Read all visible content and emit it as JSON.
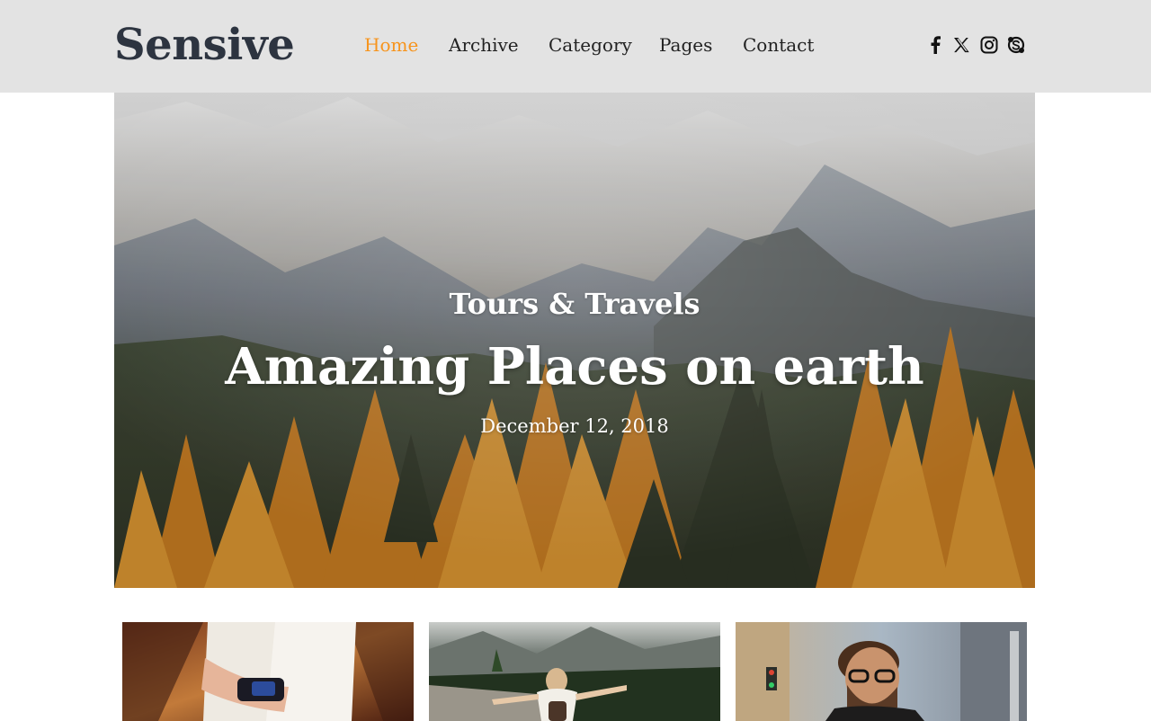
{
  "brand": {
    "logo": "Sensive"
  },
  "nav": {
    "items": [
      {
        "label": "Home",
        "active": true
      },
      {
        "label": "Archive",
        "active": false
      },
      {
        "label": "Category",
        "active": false
      },
      {
        "label": "Pages",
        "active": false
      },
      {
        "label": "Contact",
        "active": false
      }
    ]
  },
  "social": {
    "icons": [
      "facebook-icon",
      "x-icon",
      "instagram-icon",
      "skype-icon"
    ]
  },
  "hero": {
    "kicker": "Tours & Travels",
    "title": "Amazing Places on earth",
    "date": "December 12, 2018"
  },
  "cards": [
    {
      "image": "wristwatch-photo"
    },
    {
      "image": "hiker-mountain-photo"
    },
    {
      "image": "man-with-glasses-photo"
    }
  ],
  "colors": {
    "accent": "#f7941d",
    "header_bg": "#e3e3e3",
    "logo": "#2d3440",
    "nav_text": "#222222"
  }
}
